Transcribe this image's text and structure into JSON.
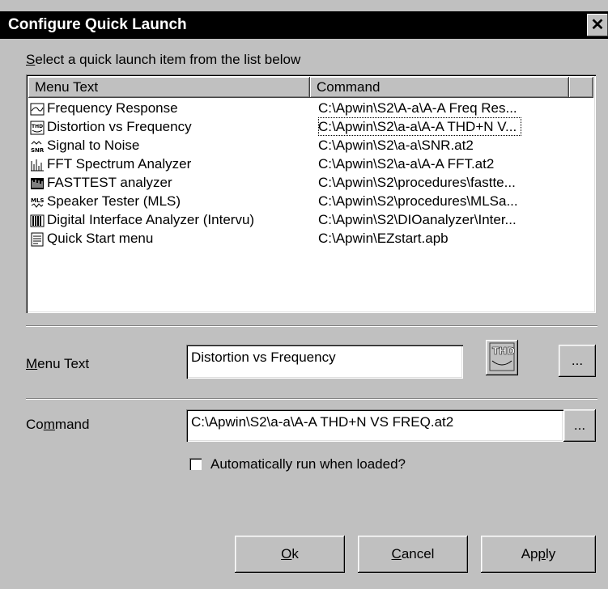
{
  "window": {
    "title": "Configure Quick Launch",
    "close_glyph": "✕"
  },
  "instruction": {
    "prefix": "S",
    "rest": "elect a quick launch item from the list below"
  },
  "list": {
    "columns": [
      "Menu Text",
      "Command"
    ],
    "rows": [
      {
        "icon": "frequency-response-icon",
        "text": "Frequency Response",
        "command": "C:\\Apwin\\S2\\A-a\\A-A Freq Res..."
      },
      {
        "icon": "thd-icon",
        "text": "Distortion vs Frequency",
        "command": "C:\\Apwin\\S2\\a-a\\A-A THD+N V...",
        "selected": true
      },
      {
        "icon": "snr-icon",
        "text": "Signal to Noise",
        "command": "C:\\Apwin\\S2\\a-a\\SNR.at2"
      },
      {
        "icon": "fft-icon",
        "text": "FFT Spectrum Analyzer",
        "command": "C:\\Apwin\\S2\\a-a\\A-A FFT.at2"
      },
      {
        "icon": "fasttest-icon",
        "text": "FASTTEST analyzer",
        "command": "C:\\Apwin\\S2\\procedures\\fastte..."
      },
      {
        "icon": "mls-icon",
        "text": "Speaker Tester (MLS)",
        "command": "C:\\Apwin\\S2\\procedures\\MLSa..."
      },
      {
        "icon": "intervu-icon",
        "text": "Digital Interface Analyzer (Intervu)",
        "command": "C:\\Apwin\\S2\\DIOanalyzer\\Inter..."
      },
      {
        "icon": "quickstart-icon",
        "text": "Quick Start menu",
        "command": "C:\\Apwin\\EZstart.apb"
      }
    ]
  },
  "menu_text": {
    "label_u": "M",
    "label_rest": "enu Text",
    "value": "Distortion vs Frequency",
    "icon_text": "THD",
    "browse": "..."
  },
  "command": {
    "label_pre": "Co",
    "label_u": "m",
    "label_rest": "mand",
    "value": "C:\\Apwin\\S2\\a-a\\A-A THD+N VS FREQ.at2",
    "browse": "..."
  },
  "autorun": {
    "label": "Automatically run when loaded?",
    "checked": false
  },
  "buttons": {
    "ok_u": "O",
    "ok_rest": "k",
    "cancel_u": "C",
    "cancel_rest": "ancel",
    "apply_pre": "Ap",
    "apply_u": "p",
    "apply_rest": "ly"
  }
}
